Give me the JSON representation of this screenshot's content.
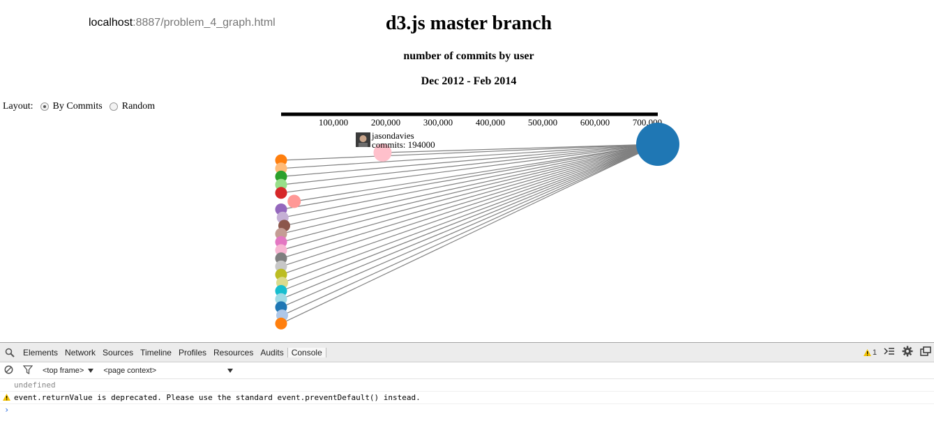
{
  "browser": {
    "url_host": "localhost",
    "url_path": ":8887/problem_4_graph.html"
  },
  "page": {
    "title": "d3.js master branch",
    "subtitle": "number of commits by user",
    "date_range": "Dec 2012 - Feb 2014"
  },
  "layout_control": {
    "label": "Layout:",
    "options": [
      {
        "label": "By Commits",
        "checked": true
      },
      {
        "label": "Random",
        "checked": false
      }
    ]
  },
  "chart_data": {
    "type": "scatter",
    "axis": {
      "domain": [
        0,
        720000
      ],
      "ticks": [
        100000,
        200000,
        300000,
        400000,
        500000,
        600000,
        700000
      ],
      "tick_labels": [
        "100,000",
        "200,000",
        "300,000",
        "400,000",
        "500,000",
        "600,000",
        "700,000"
      ]
    },
    "hub": {
      "commits": 720000,
      "color": "#1f77b4"
    },
    "tooltip": {
      "user": "jasondavies",
      "commits_label": "commits: 194000"
    },
    "nodes": [
      {
        "commits": 194000,
        "color": "#ffc0cb"
      },
      {
        "commits": 25000,
        "color": "#ff9896"
      },
      {
        "commits": 0,
        "color": "#ff7f0e"
      },
      {
        "commits": 0,
        "color": "#ffbb78"
      },
      {
        "commits": 0,
        "color": "#2ca02c"
      },
      {
        "commits": 0,
        "color": "#98df8a"
      },
      {
        "commits": 0,
        "color": "#d62728"
      },
      {
        "commits": 0,
        "color": "#9467bd"
      },
      {
        "commits": 3000,
        "color": "#c5b0d5"
      },
      {
        "commits": 6000,
        "color": "#8c564b"
      },
      {
        "commits": 0,
        "color": "#c49c94"
      },
      {
        "commits": 0,
        "color": "#e377c2"
      },
      {
        "commits": 0,
        "color": "#f7b6d2"
      },
      {
        "commits": 0,
        "color": "#7f7f7f"
      },
      {
        "commits": 0,
        "color": "#c7c7c7"
      },
      {
        "commits": 0,
        "color": "#bcbd22"
      },
      {
        "commits": 2000,
        "color": "#dbdb8d"
      },
      {
        "commits": 0,
        "color": "#17becf"
      },
      {
        "commits": 0,
        "color": "#9edae5"
      },
      {
        "commits": 0,
        "color": "#1f77b4"
      },
      {
        "commits": 2000,
        "color": "#aec7e8"
      },
      {
        "commits": 0,
        "color": "#ff7f0e"
      }
    ]
  },
  "devtools": {
    "tabs": [
      "Elements",
      "Network",
      "Sources",
      "Timeline",
      "Profiles",
      "Resources",
      "Audits",
      "Console"
    ],
    "active_tab": "Console",
    "warning_count": "1",
    "frame_select": "<top frame>",
    "context_select": "<page context>",
    "console_lines": [
      {
        "text": "undefined",
        "level": "result"
      },
      {
        "text": "event.returnValue is deprecated. Please use the standard event.preventDefault() instead.",
        "level": "warning"
      }
    ],
    "prompt": "›"
  }
}
